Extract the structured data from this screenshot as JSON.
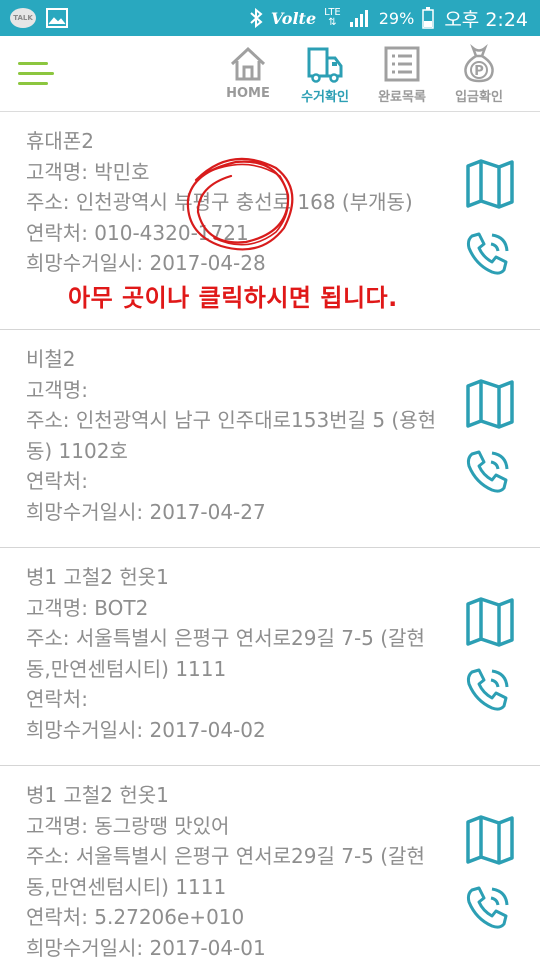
{
  "status_bar": {
    "talk_icon_label": "TALK",
    "volte": "Volte",
    "network": "LTE",
    "battery_percent": "29%",
    "ampm": "오후",
    "time": "2:24"
  },
  "tabs": [
    {
      "label": "HOME",
      "icon": "home-icon",
      "active": false
    },
    {
      "label": "수거확인",
      "icon": "truck-icon",
      "active": true
    },
    {
      "label": "완료목록",
      "icon": "list-icon",
      "active": false
    },
    {
      "label": "입금확인",
      "icon": "money-bag-icon",
      "active": false
    }
  ],
  "items": [
    {
      "title": "휴대폰2",
      "customer": "고객명: 박민호",
      "address": "주소: 인천광역시 부평구 충선로 168 (부개동)",
      "contact": "연락처: 010-4320-1721",
      "date": "희망수거일시: 2017-04-28"
    },
    {
      "title": "비철2",
      "customer": "고객명:",
      "address": "주소: 인천광역시 남구 인주대로153번길 5 (용현동) 1102호",
      "contact": "연락처:",
      "date": "희망수거일시: 2017-04-27"
    },
    {
      "title": "병1 고철2 헌옷1",
      "customer": "고객명: BOT2",
      "address": "주소: 서울특별시 은평구 연서로29길 7-5 (갈현동,만연센텀시티) 1111",
      "contact": "연락처:",
      "date": "희망수거일시: 2017-04-02"
    },
    {
      "title": "병1 고철2 헌옷1",
      "customer": "고객명: 동그랑땡 맛있어",
      "address": "주소: 서울특별시 은평구 연서로29길 7-5 (갈현동,만연센텀시티) 1111",
      "contact": "연락처: 5.27206e+010",
      "date": "희망수거일시: 2017-04-01"
    }
  ],
  "overlay_hint": "아무 곳이나 클릭하시면 됩니다.",
  "colors": {
    "status_bar": "#29a8bf",
    "accent": "#2c9fb4",
    "menu": "#8cc63f",
    "hint": "#e01818",
    "text": "#8e8e8e"
  }
}
